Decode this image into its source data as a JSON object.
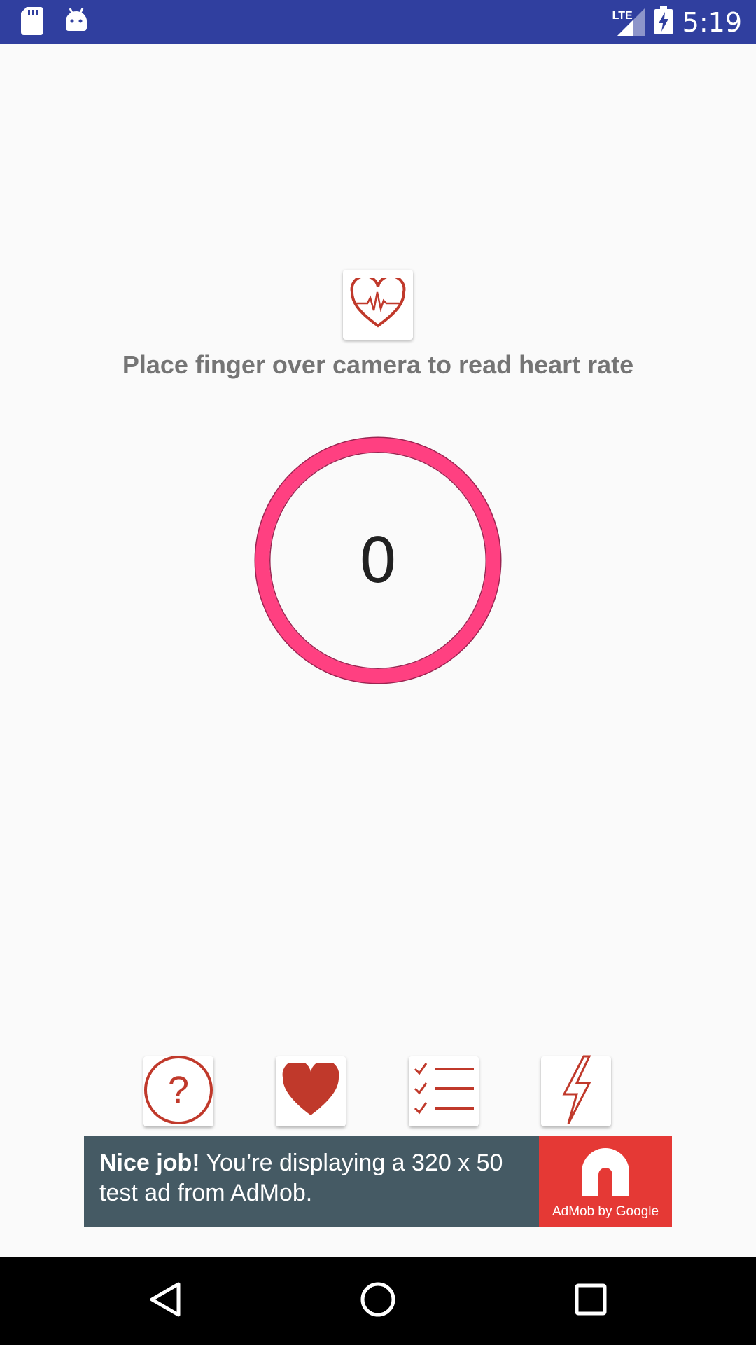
{
  "status_bar": {
    "time": "5:19",
    "network": "LTE",
    "icons": [
      "sd-card-icon",
      "android-icon",
      "lte-signal-icon",
      "battery-charging-icon"
    ]
  },
  "main": {
    "logo_icon": "heart-pulse-icon",
    "instruction": "Place finger over camera to read heart rate",
    "bpm_value": "0",
    "ring_color": "#ff4081",
    "accent_color": "#c0392b"
  },
  "toolbar": {
    "buttons": [
      {
        "icon": "help-icon"
      },
      {
        "icon": "heart-icon"
      },
      {
        "icon": "checklist-icon"
      },
      {
        "icon": "flash-icon"
      }
    ]
  },
  "ad": {
    "bold_text": "Nice job!",
    "text": " You’re displaying a 320 x 50 test ad from AdMob.",
    "logo_caption": "AdMob by Google"
  },
  "nav": {
    "buttons": [
      "back-icon",
      "home-icon",
      "recents-icon"
    ]
  }
}
